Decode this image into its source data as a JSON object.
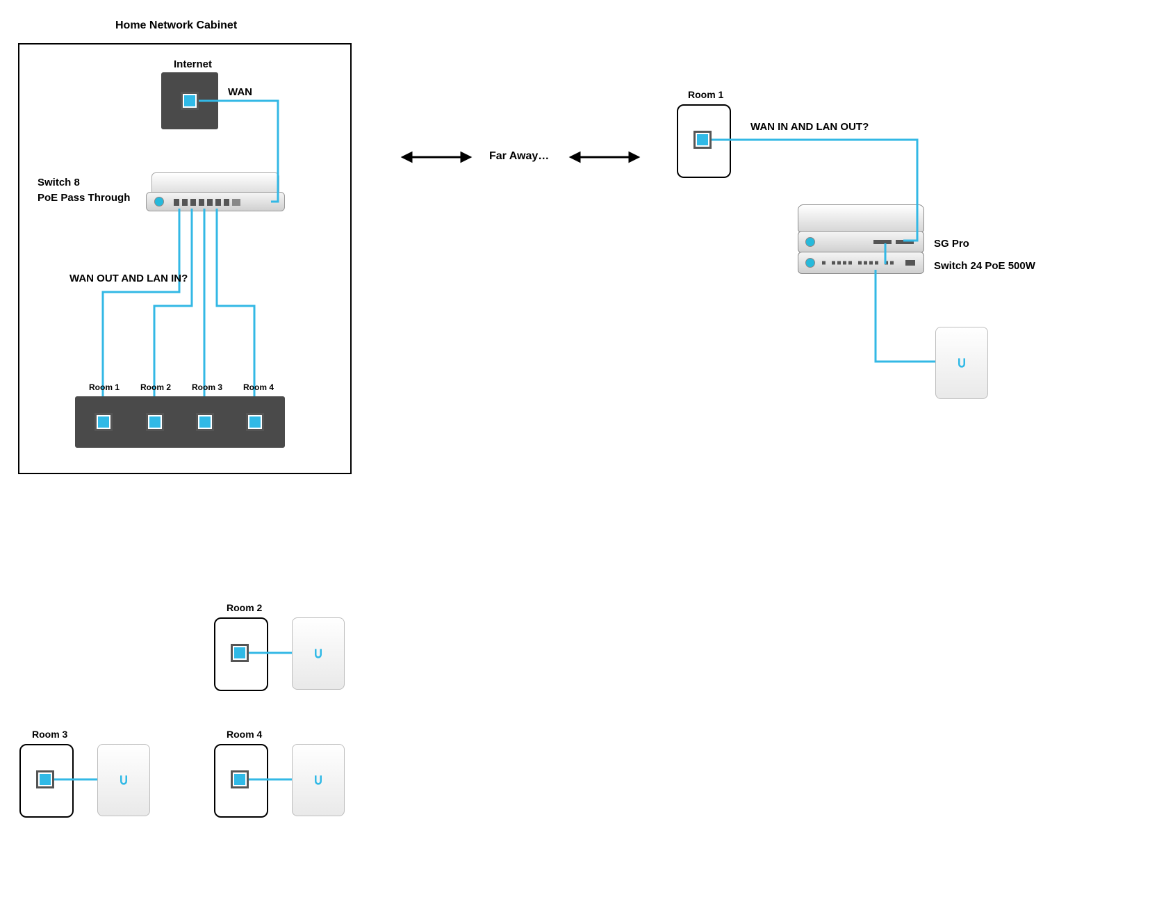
{
  "title": "Home Network Cabinet",
  "cabinet": {
    "internet_label": "Internet",
    "wan_label": "WAN",
    "switch_label_line1": "Switch 8",
    "switch_label_line2": "PoE Pass Through",
    "question": "WAN OUT AND LAN IN?",
    "rooms": [
      "Room 1",
      "Room 2",
      "Room 3",
      "Room 4"
    ]
  },
  "far_label": "Far Away…",
  "right": {
    "room1": "Room 1",
    "question": "WAN  IN AND LAN OUT?",
    "sg_label": "SG Pro",
    "switch24_label": "Switch 24 PoE 500W"
  },
  "bottom": {
    "room2": "Room 2",
    "room3": "Room 3",
    "room4": "Room 4"
  },
  "colors": {
    "cable": "#33b8e5",
    "panel": "#4a4a4a"
  }
}
